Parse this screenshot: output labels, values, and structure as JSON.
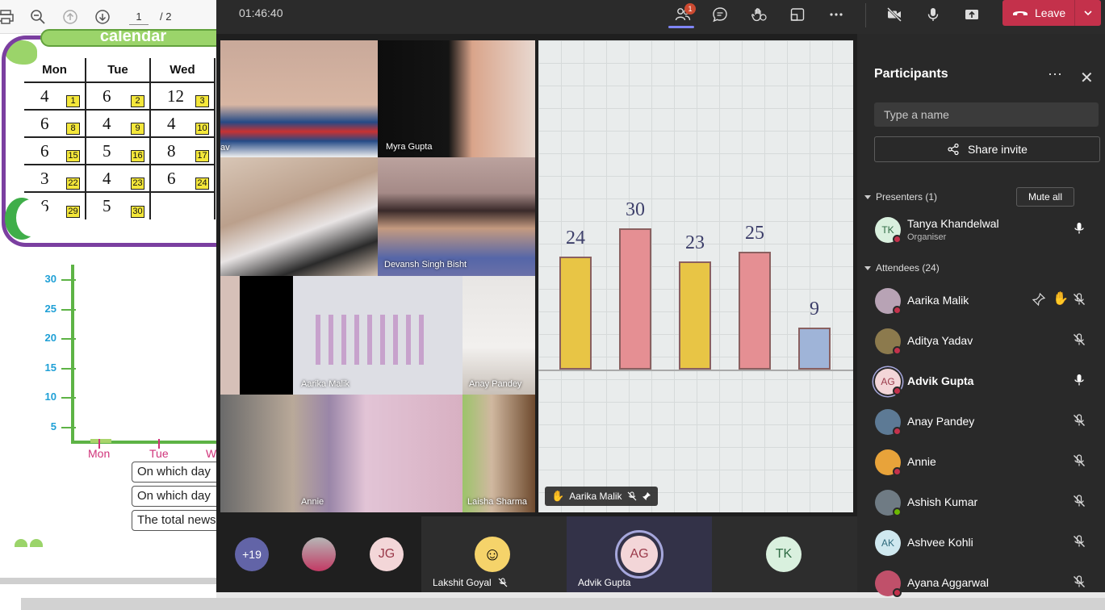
{
  "pdf": {
    "page_current": "1",
    "page_total": "/ 2",
    "calendar_title": "calendar",
    "calendar_headers": [
      "Mon",
      "Tue",
      "Wed"
    ],
    "calendar_rows": [
      [
        {
          "value": "4",
          "day": "1"
        },
        {
          "value": "6",
          "day": "2"
        },
        {
          "value": "12",
          "day": "3"
        }
      ],
      [
        {
          "value": "6",
          "day": "8"
        },
        {
          "value": "4",
          "day": "9"
        },
        {
          "value": "4",
          "day": "10"
        }
      ],
      [
        {
          "value": "6",
          "day": "15"
        },
        {
          "value": "5",
          "day": "16"
        },
        {
          "value": "8",
          "day": "17"
        }
      ],
      [
        {
          "value": "3",
          "day": "22"
        },
        {
          "value": "4",
          "day": "23"
        },
        {
          "value": "6",
          "day": "24"
        }
      ],
      [
        {
          "value": "6",
          "day": "29"
        },
        {
          "value": "5",
          "day": "30"
        },
        {
          "value": "",
          "day": ""
        }
      ]
    ],
    "graph_yticks": [
      "30",
      "25",
      "20",
      "15",
      "10",
      "5"
    ],
    "graph_xlabels": [
      "Mon",
      "Tue",
      "W"
    ],
    "questions": [
      "On which day",
      "On which day",
      "The total news"
    ]
  },
  "meeting": {
    "timer": "01:46:40",
    "people_badge": "1",
    "leave_label": "Leave",
    "tiles": {
      "t1": "av",
      "t2": "Myra Gupta",
      "t3": "",
      "t4": "Devansh Singh Bisht",
      "t5": "Aarika Malik",
      "t6": "Anay Pandey",
      "t7": "Annie",
      "t8": "Laisha Sharma"
    },
    "pinned": {
      "name": "Aarika Malik",
      "bars": [
        {
          "label": "24",
          "value": 24,
          "color": "#e8c545"
        },
        {
          "label": "30",
          "value": 30,
          "color": "#e58f93"
        },
        {
          "label": "23",
          "value": 23,
          "color": "#e8c545"
        },
        {
          "label": "25",
          "value": 25,
          "color": "#e58f93"
        },
        {
          "label": "9",
          "value": 9,
          "color": "#9fb4d8"
        }
      ]
    },
    "strip": {
      "overflow": "+19",
      "jg_initials": "JG",
      "lakshit": "Lakshit Goyal",
      "ag_initials": "AG",
      "advik": "Advik Gupta",
      "tk_initials": "TK"
    }
  },
  "participants": {
    "title": "Participants",
    "search_placeholder": "Type a name",
    "share_invite": "Share invite",
    "presenters_label": "Presenters (1)",
    "mute_all": "Mute all",
    "attendees_label": "Attendees (24)",
    "presenter": {
      "initials": "TK",
      "name": "Tanya Khandelwal",
      "role": "Organiser"
    },
    "attendees": [
      {
        "name": "Aarika Malik",
        "initials": "",
        "avatar": "#b8a3b5",
        "status": "#c4314b",
        "bold": false
      },
      {
        "name": "Aditya Yadav",
        "initials": "",
        "avatar": "#8c7a4d",
        "status": "#c4314b",
        "bold": false
      },
      {
        "name": "Advik Gupta",
        "initials": "AG",
        "avatar": "#f3d6d8",
        "status": "#c4314b",
        "bold": true
      },
      {
        "name": "Anay Pandey",
        "initials": "",
        "avatar": "#5d7a95",
        "status": "#c4314b",
        "bold": false
      },
      {
        "name": "Annie",
        "initials": "",
        "avatar": "#e8a33a",
        "status": "#c4314b",
        "bold": false
      },
      {
        "name": "Ashish Kumar",
        "initials": "",
        "avatar": "#6f7b84",
        "status": "#6bb700",
        "bold": false
      },
      {
        "name": "Ashvee Kohli",
        "initials": "AK",
        "avatar": "#cfe8ef",
        "status": "",
        "bold": false
      },
      {
        "name": "Ayana Aggarwal",
        "initials": "",
        "avatar": "#c0506a",
        "status": "#c4314b",
        "bold": false
      }
    ]
  }
}
